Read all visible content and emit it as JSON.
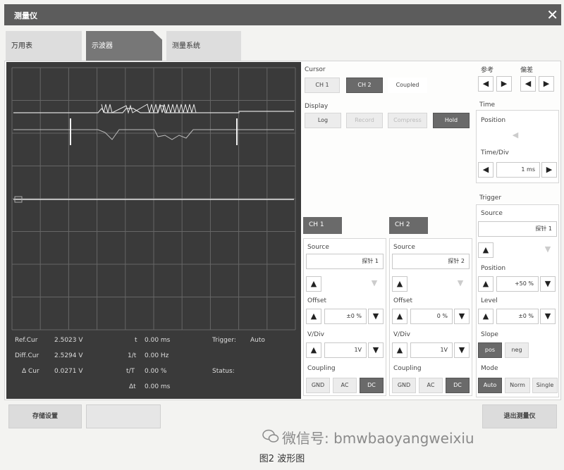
{
  "window": {
    "title": "测量仪",
    "close_icon": "close-icon"
  },
  "tabs": [
    {
      "label": "万用表",
      "active": false
    },
    {
      "label": "示波器",
      "active": true
    },
    {
      "label": "测量系统",
      "active": false
    }
  ],
  "readouts": {
    "ref_cur_label": "Ref.Cur",
    "ref_cur_value": "2.5023 V",
    "diff_cur_label": "Diff.Cur",
    "diff_cur_value": "2.5294 V",
    "delta_cur_label": "Δ Cur",
    "delta_cur_value": "0.0271 V",
    "t_label": "t",
    "t_value": "0.00 ms",
    "inv_t_label": "1/t",
    "inv_t_value": "0.00 Hz",
    "t_over_T_label": "t/T",
    "t_over_T_value": "0.00 %",
    "delta_t_label": "Δt",
    "delta_t_value": "0.00 ms",
    "trigger_label": "Trigger:",
    "trigger_value": "Auto",
    "status_label": "Status:"
  },
  "cursor": {
    "label": "Cursor",
    "buttons": [
      {
        "label": "CH 1",
        "active": false
      },
      {
        "label": "CH 2",
        "active": true
      },
      {
        "label": "Coupled",
        "active": false
      }
    ]
  },
  "reference": {
    "label": "参考"
  },
  "deviation": {
    "label": "偏差"
  },
  "display": {
    "label": "Display",
    "buttons": [
      {
        "label": "Log",
        "state": "normal"
      },
      {
        "label": "Record",
        "state": "faded"
      },
      {
        "label": "Compress",
        "state": "faded"
      },
      {
        "label": "Hold",
        "state": "active"
      }
    ]
  },
  "time": {
    "label": "Time",
    "position_label": "Position",
    "time_div_label": "Time/Div",
    "time_div_value": "1 ms"
  },
  "ch1": {
    "header": "CH 1",
    "source_label": "Source",
    "source_value": "探针 1",
    "offset_label": "Offset",
    "offset_value": "±0 %",
    "vdiv_label": "V/Div",
    "vdiv_value": "1V",
    "coupling_label": "Coupling",
    "coupling": [
      "GND",
      "AC",
      "DC"
    ],
    "coupling_selected": "DC"
  },
  "ch2": {
    "header": "CH 2",
    "source_label": "Source",
    "source_value": "探针 2",
    "offset_label": "Offset",
    "offset_value": "0 %",
    "vdiv_label": "V/Div",
    "vdiv_value": "1V",
    "coupling_label": "Coupling",
    "coupling": [
      "GND",
      "AC",
      "DC"
    ],
    "coupling_selected": "DC"
  },
  "trigger": {
    "label": "Trigger",
    "source_label": "Source",
    "source_value": "探针 1",
    "position_label": "Position",
    "position_value": "+50 %",
    "level_label": "Level",
    "level_value": "±0 %",
    "slope_label": "Slope",
    "slope": [
      "pos",
      "neg"
    ],
    "slope_selected": "pos",
    "mode_label": "Mode",
    "mode": [
      "Auto",
      "Norm",
      "Single"
    ],
    "mode_selected": "Auto"
  },
  "bottom": {
    "save_label": "存储设置",
    "exit_label": "退出测量仪"
  },
  "watermark": "微信号: bmwbaoyangweixiu",
  "caption": "图2  波形图",
  "colors": {
    "scope_bg": "#3a3a3a",
    "grid": "#6a6a6a",
    "trace": "#e6e6e6",
    "dark_button": "#6a6a6a"
  }
}
